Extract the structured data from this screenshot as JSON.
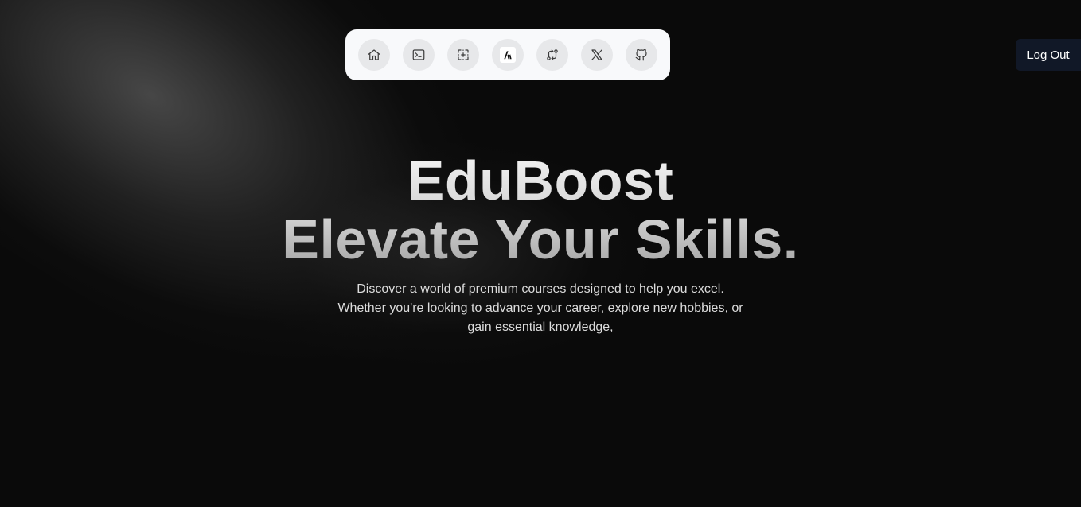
{
  "dock": {
    "items": [
      {
        "icon": "home-icon"
      },
      {
        "icon": "terminal-icon"
      },
      {
        "icon": "add-frame-icon"
      },
      {
        "icon": "brand-logo-icon"
      },
      {
        "icon": "git-compare-icon"
      },
      {
        "icon": "x-twitter-icon"
      },
      {
        "icon": "github-icon"
      }
    ]
  },
  "header": {
    "logout_label": "Log Out"
  },
  "hero": {
    "title_line1": "EduBoost",
    "title_line2": "Elevate Your Skills.",
    "description_line1": "Discover a world of premium courses designed to help you excel.",
    "description_line2": "Whether you're looking to advance your career, explore new hobbies, or",
    "description_line3": "gain essential knowledge,"
  },
  "colors": {
    "background": "#0a0a0a",
    "dock_background": "#f8f9fb",
    "dock_button": "#e7e8ea",
    "logout_background": "#111827",
    "description_text": "#dcdcdc"
  }
}
